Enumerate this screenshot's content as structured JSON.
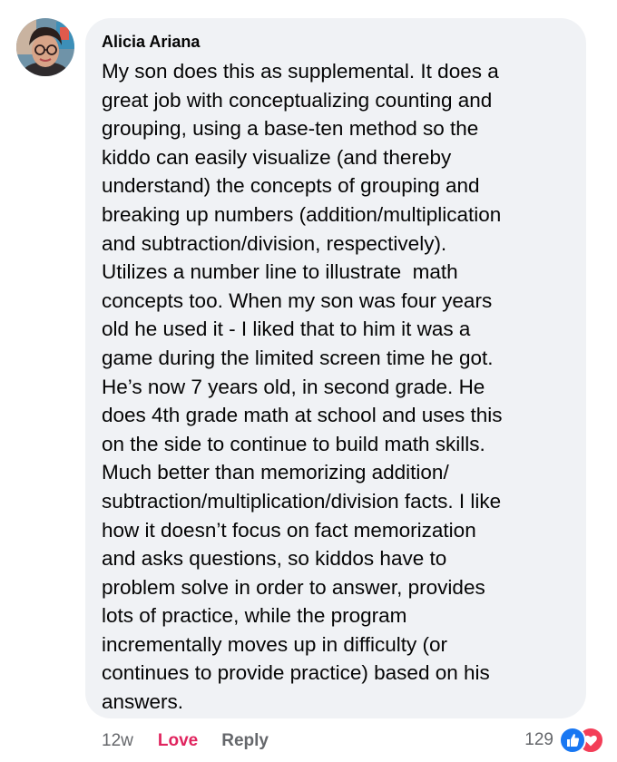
{
  "comment": {
    "author": "Alicia Ariana",
    "text_lines": [
      "My son does this as supplemental. It does a",
      "great job with conceptualizing counting and",
      "grouping, using a base-ten method so the",
      "kiddo can easily visualize (and thereby",
      "understand) the concepts of grouping and",
      "breaking up numbers (addition/multiplication",
      "and subtraction/division, respectively).",
      "Utilizes a number line to illustrate  math",
      "concepts too. When my son was four years",
      "old he used it - I liked that to him it was a",
      "game during the limited screen time he got.",
      "He’s now 7 years old, in second grade. He",
      "does 4th grade math at school and uses this",
      "on the side to continue to build math skills.",
      "Much better than memorizing addition/",
      "subtraction/multiplication/division facts. I like",
      "how it doesn’t focus on fact memorization",
      "and asks questions, so kiddos have to",
      "problem solve in order to answer, provides",
      "lots of practice, while the program",
      "incrementally moves up in difficulty (or",
      "continues to provide practice) based on his",
      "answers."
    ]
  },
  "actions": {
    "time": "12w",
    "love_label": "Love",
    "reply_label": "Reply"
  },
  "reactions": {
    "count": "129",
    "icons": [
      "like-icon",
      "love-icon"
    ]
  },
  "colors": {
    "bubble": "#f0f2f5",
    "love": "#e0245e",
    "like_badge": "#1877f2",
    "love_badge": "#f33e58",
    "meta_text": "#65676b"
  }
}
